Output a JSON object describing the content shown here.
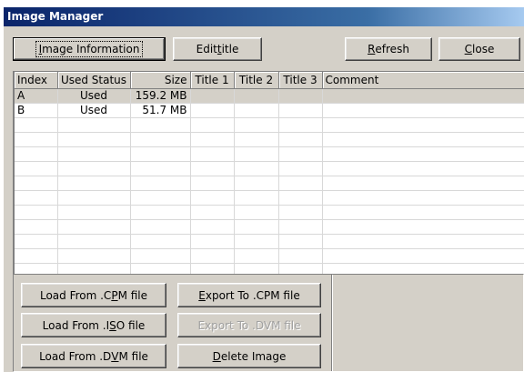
{
  "window": {
    "title": "Image Manager"
  },
  "toolbar": {
    "image_information": {
      "pre": "",
      "u": "I",
      "post": "mage Information"
    },
    "edit_title": {
      "pre": "Edit ",
      "u": "t",
      "post": "itle"
    },
    "refresh": {
      "pre": "",
      "u": "R",
      "post": "efresh"
    },
    "close": {
      "pre": "",
      "u": "C",
      "post": "lose"
    }
  },
  "table": {
    "columns": [
      "Index",
      "Used Status",
      "Size",
      "Title 1",
      "Title 2",
      "Title 3",
      "Comment"
    ],
    "rows": [
      {
        "index": "A",
        "status": "Used",
        "size": "159.2 MB",
        "title1": "",
        "title2": "",
        "title3": "",
        "comment": ""
      },
      {
        "index": "B",
        "status": "Used",
        "size": "51.7 MB",
        "title1": "",
        "title2": "",
        "title3": "",
        "comment": ""
      }
    ]
  },
  "actions": {
    "load_cpm": {
      "pre": "Load From .C",
      "u": "P",
      "post": "M file"
    },
    "load_iso": {
      "pre": "Load From .I",
      "u": "S",
      "post": "O file"
    },
    "load_dvm": {
      "pre": "Load From .D",
      "u": "V",
      "post": "M file"
    },
    "export_cpm": {
      "pre": "",
      "u": "E",
      "post": "xport To .CPM file"
    },
    "export_dvm": {
      "pre": "Export To .DVM file",
      "u": "",
      "post": ""
    },
    "delete_image": {
      "pre": "",
      "u": "D",
      "post": "elete Image"
    }
  }
}
